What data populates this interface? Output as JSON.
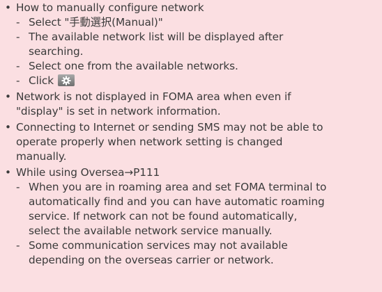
{
  "items": [
    {
      "lines": [
        "How to manually configure network"
      ],
      "subs": [
        {
          "lines": [
            "Select \"手動選択(Manual)\""
          ]
        },
        {
          "lines": [
            "The available network list will be displayed after",
            "searching."
          ]
        },
        {
          "lines": [
            "Select one from the available networks."
          ]
        },
        {
          "lines": [
            "Click"
          ]
        }
      ]
    },
    {
      "lines": [
        "Network is not displayed in FOMA area when even if",
        "\"display\" is set in network information."
      ]
    },
    {
      "lines": [
        "Connecting to Internet or sending SMS may not be able to",
        "operate properly when network setting is changed",
        "manually."
      ]
    },
    {
      "lines": [
        "While using Oversea→P111"
      ],
      "subs": [
        {
          "lines": [
            "When you are in roaming area and set FOMA terminal to",
            "automatically find and you can have automatic roaming",
            "service. If network can not be found automatically,",
            "select the available network service manually."
          ]
        },
        {
          "lines": [
            "Some communication services may not available",
            "depending on the overseas carrier or network."
          ]
        }
      ]
    }
  ],
  "bullet_glyph": "•",
  "dash_glyph": "-",
  "icons": {
    "click_icon": "gear-settings-icon"
  },
  "colors": {
    "background": "#fbdfe2",
    "text": "#3b3b3b",
    "icon_bg": "#8a8a8a"
  }
}
